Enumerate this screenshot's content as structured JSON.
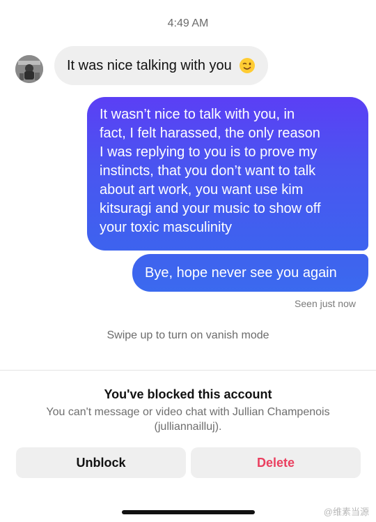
{
  "thread": {
    "timestamp": "4:49 AM",
    "incoming": {
      "text": "It was nice talking with you",
      "emoji_icon": "winking-face-emoji-icon"
    },
    "outgoing_messages": [
      {
        "text": "It wasn’t nice to talk with you, in\nfact, I felt harassed, the only reason\nI was replying to you is to prove my\ninstincts, that you don’t want to talk\nabout art work, you want use kim\nkitsuragi and your music to show off\nyour toxic masculinity"
      },
      {
        "text": "Bye, hope never see you again"
      }
    ],
    "seen_status": "Seen just now",
    "vanish_hint": "Swipe up to turn on vanish mode"
  },
  "blocked": {
    "title": "You've blocked this account",
    "subtitle": "You can't message or video chat with Jullian Champenois (julliannailluj).",
    "unblock_label": "Unblock",
    "delete_label": "Delete"
  },
  "watermark": "@维素当源",
  "colors": {
    "outgoing_bubble_top": "#5b3ff5",
    "outgoing_bubble_bottom": "#3d63ef",
    "incoming_bubble": "#efefef",
    "delete_red": "#ea3f5f"
  }
}
